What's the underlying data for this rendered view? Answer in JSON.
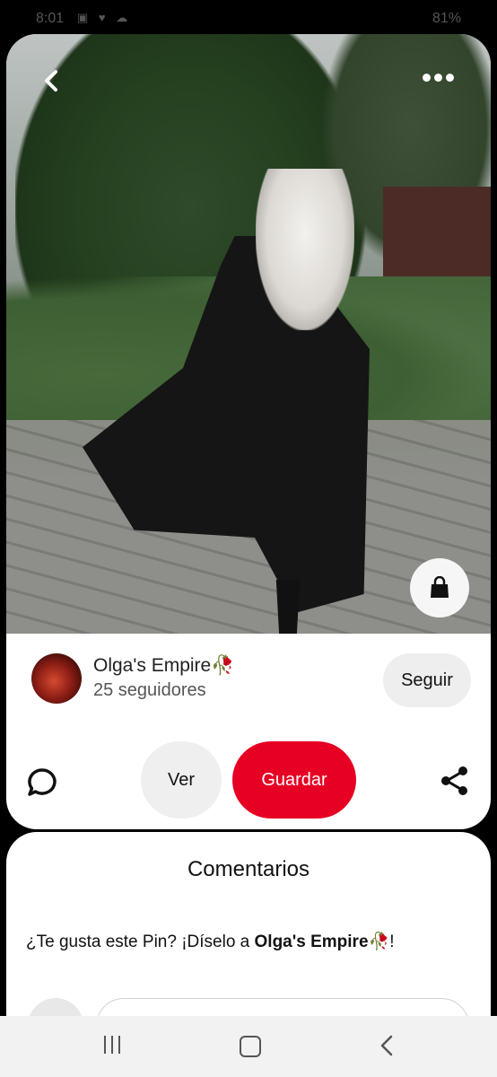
{
  "status_bar": {
    "time": "8:01",
    "battery": "81%"
  },
  "pin": {
    "image_alt": "Woman with long platinum hair walking in a flowing black satin coat",
    "back_icon": "chevron-left-icon",
    "more_icon": "more-dots-icon",
    "shop_icon": "shopping-bag-icon"
  },
  "creator": {
    "name": "Olga's Empire🥀",
    "followers": "25 seguidores",
    "follow_label": "Seguir"
  },
  "actions": {
    "comment_icon": "comment-bubble-icon",
    "view_label": "Ver",
    "save_label": "Guardar",
    "save_color": "#e60023",
    "share_icon": "share-icon"
  },
  "comments": {
    "title": "Comentarios",
    "prompt_text": "¿Te gusta este Pin? ¡Díselo a ",
    "prompt_name": "Olga's Empire🥀",
    "prompt_end": "!",
    "input_placeholder": ""
  },
  "nav_bar": {
    "recents_icon": "recents-icon",
    "home_icon": "home-icon",
    "back_icon": "back-icon"
  }
}
